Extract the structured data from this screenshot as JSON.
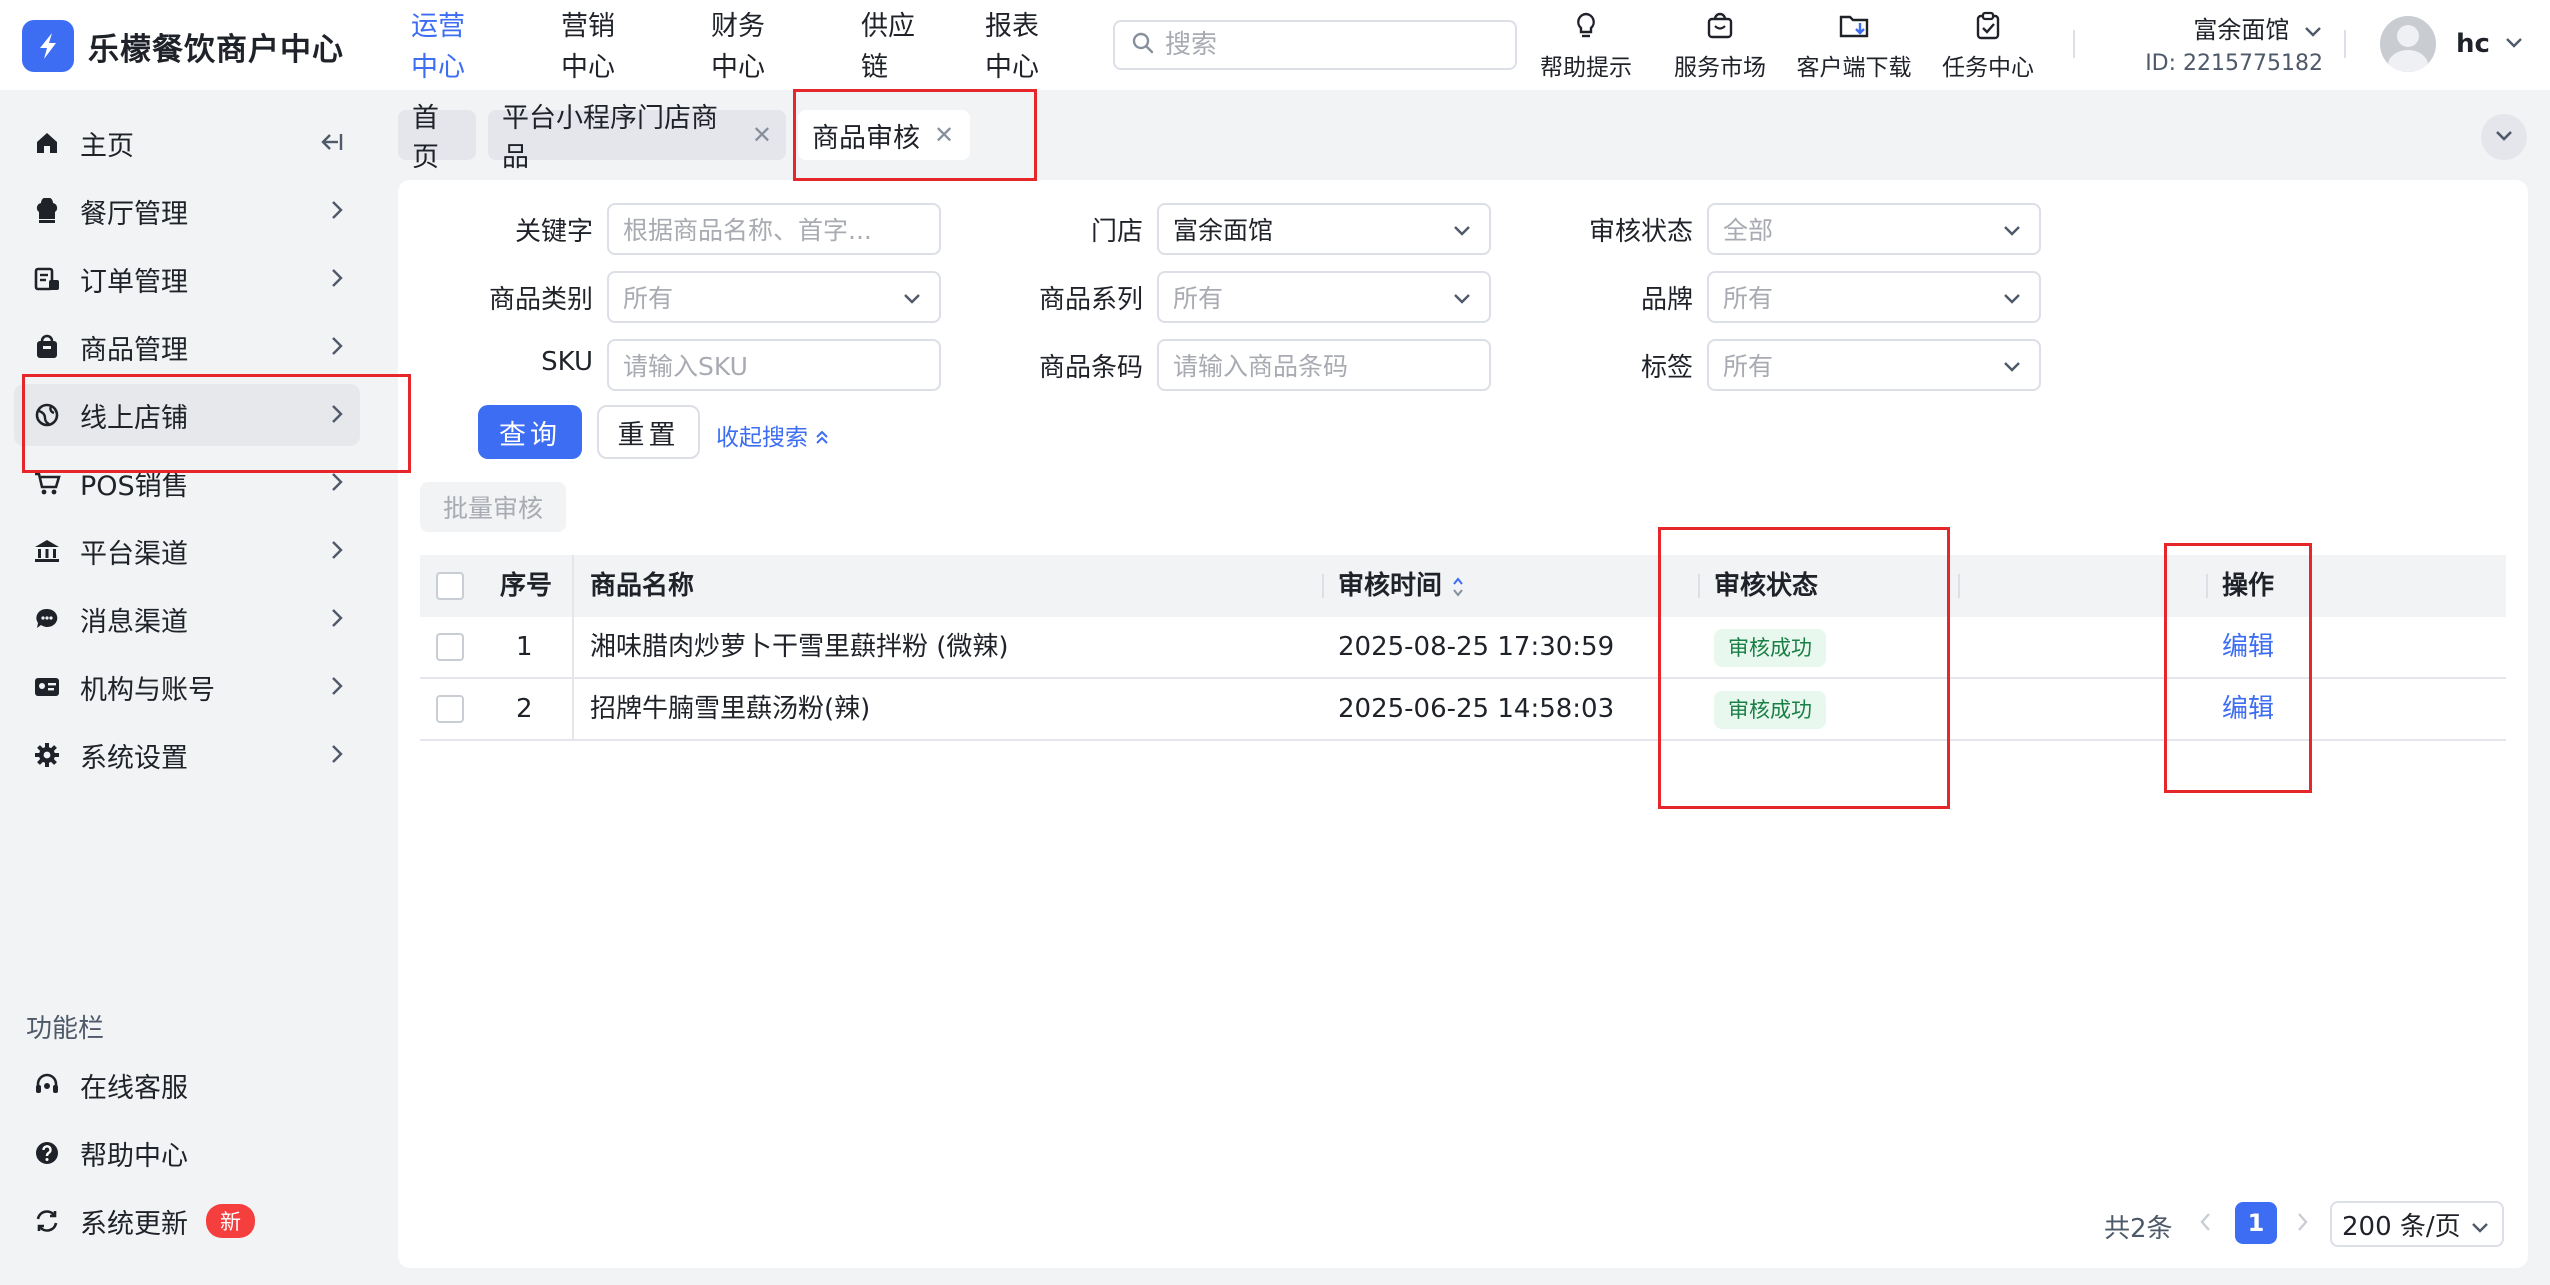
{
  "app": {
    "title": "乐檬餐饮商户中心"
  },
  "topnav": [
    "运营中心",
    "营销中心",
    "财务中心",
    "供应链",
    "报表中心"
  ],
  "search": {
    "placeholder": "搜索"
  },
  "tools": [
    {
      "label": "帮助提示",
      "icon": "lightbulb-icon"
    },
    {
      "label": "服务市场",
      "icon": "shopping-bag-icon"
    },
    {
      "label": "客户端下载",
      "icon": "folder-download-icon"
    },
    {
      "label": "任务中心",
      "icon": "clipboard-check-icon"
    }
  ],
  "store": {
    "name": "富余面馆",
    "id": "ID: 2215775182"
  },
  "user": {
    "name": "hc"
  },
  "sidebar": {
    "items": [
      {
        "label": "主页",
        "icon": "home-icon"
      },
      {
        "label": "餐厅管理",
        "icon": "chef-hat-icon"
      },
      {
        "label": "订单管理",
        "icon": "order-icon"
      },
      {
        "label": "商品管理",
        "icon": "product-bag-icon"
      },
      {
        "label": "线上店铺",
        "icon": "globe-icon"
      },
      {
        "label": "POS销售",
        "icon": "cart-icon"
      },
      {
        "label": "平台渠道",
        "icon": "bank-icon"
      },
      {
        "label": "消息渠道",
        "icon": "message-icon"
      },
      {
        "label": "机构与账号",
        "icon": "id-card-icon"
      },
      {
        "label": "系统设置",
        "icon": "gear-icon"
      }
    ],
    "section_title": "功能栏",
    "bottom": [
      {
        "label": "在线客服",
        "icon": "headset-icon"
      },
      {
        "label": "帮助中心",
        "icon": "help-icon"
      },
      {
        "label": "系统更新",
        "icon": "refresh-icon",
        "badge": "新"
      }
    ]
  },
  "tabs": [
    {
      "label": "首页",
      "closable": false
    },
    {
      "label": "平台小程序门店商品",
      "closable": true
    },
    {
      "label": "商品审核",
      "closable": true,
      "active": true
    }
  ],
  "filters": {
    "keyword": {
      "label": "关键字",
      "placeholder": "根据商品名称、首字..."
    },
    "store": {
      "label": "门店",
      "value": "富余面馆"
    },
    "audit_status": {
      "label": "审核状态",
      "placeholder": "全部"
    },
    "category": {
      "label": "商品类别",
      "placeholder": "所有"
    },
    "series": {
      "label": "商品系列",
      "placeholder": "所有"
    },
    "brand": {
      "label": "品牌",
      "placeholder": "所有"
    },
    "sku": {
      "label": "SKU",
      "placeholder": "请输入SKU"
    },
    "barcode": {
      "label": "商品条码",
      "placeholder": "请输入商品条码"
    },
    "tag": {
      "label": "标签",
      "placeholder": "所有"
    }
  },
  "buttons": {
    "query": "查询",
    "reset": "重置",
    "collapse": "收起搜索",
    "batch_audit": "批量审核"
  },
  "table": {
    "headers": {
      "index": "序号",
      "name": "商品名称",
      "audit_time": "审核时间",
      "status": "审核状态",
      "action": "操作"
    },
    "rows": [
      {
        "index": "1",
        "name": "湘味腊肉炒萝卜干雪里蕻拌粉 (微辣)",
        "audit_time": "2025-08-25 17:30:59",
        "status": "审核成功",
        "action": "编辑"
      },
      {
        "index": "2",
        "name": "招牌牛腩雪里蕻汤粉(辣)",
        "audit_time": "2025-06-25 14:58:03",
        "status": "审核成功",
        "action": "编辑"
      }
    ]
  },
  "pagination": {
    "total": "共2条",
    "current": "1",
    "page_size": "200 条/页"
  },
  "colors": {
    "primary": "#3d6df2",
    "highlight": "#e5262b",
    "success_bg": "#e8f8ee",
    "success_text": "#1a7f45"
  }
}
